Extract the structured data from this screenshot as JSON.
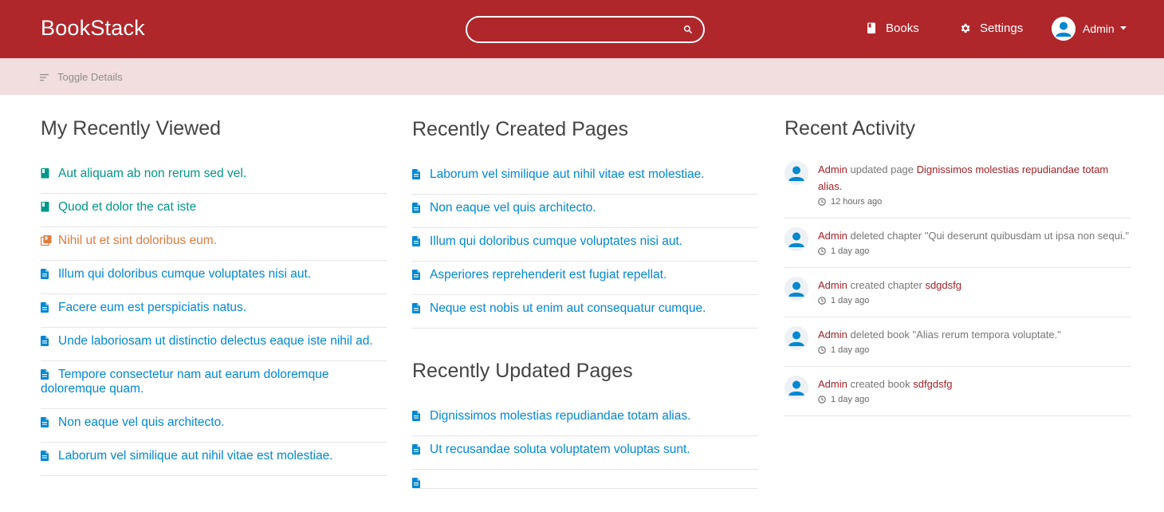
{
  "header": {
    "logo": "BookStack",
    "search_placeholder": "",
    "nav": {
      "books": "Books",
      "settings": "Settings",
      "user": "Admin"
    }
  },
  "toolbar": {
    "toggle_details": "Toggle Details"
  },
  "recently_viewed": {
    "title": "My Recently Viewed",
    "items": [
      {
        "label": "Aut aliquam ab non rerum sed vel.",
        "type": "book"
      },
      {
        "label": "Quod et dolor the cat iste",
        "type": "book"
      },
      {
        "label": "Nihil ut et sint doloribus eum.",
        "type": "shelf"
      },
      {
        "label": "Illum qui doloribus cumque voluptates nisi aut.",
        "type": "page"
      },
      {
        "label": "Facere eum est perspiciatis natus.",
        "type": "page"
      },
      {
        "label": "Unde laboriosam ut distinctio delectus eaque iste nihil ad.",
        "type": "page"
      },
      {
        "label": "Tempore consectetur nam aut earum doloremque doloremque quam.",
        "type": "page"
      },
      {
        "label": "Non eaque vel quis architecto.",
        "type": "page"
      },
      {
        "label": "Laborum vel similique aut nihil vitae est molestiae.",
        "type": "page"
      }
    ]
  },
  "recently_created": {
    "title": "Recently Created Pages",
    "items": [
      "Laborum vel similique aut nihil vitae est molestiae.",
      "Non eaque vel quis architecto.",
      "Illum qui doloribus cumque voluptates nisi aut.",
      "Asperiores reprehenderit est fugiat repellat.",
      "Neque est nobis ut enim aut consequatur cumque."
    ]
  },
  "recently_updated": {
    "title": "Recently Updated Pages",
    "items": [
      "Dignissimos molestias repudiandae totam alias.",
      "Ut recusandae soluta voluptatem voluptas sunt.",
      ""
    ]
  },
  "activity": {
    "title": "Recent Activity",
    "items": [
      {
        "user": "Admin",
        "action": "updated page",
        "target": "Dignissimos molestias repudiandae totam alias.",
        "time": "12 hours ago"
      },
      {
        "user": "Admin",
        "action": "deleted chapter \"Qui deserunt quibusdam ut ipsa non sequi.\"",
        "target": "",
        "time": "1 day ago"
      },
      {
        "user": "Admin",
        "action": "created chapter",
        "target": "sdgdsfg",
        "time": "1 day ago"
      },
      {
        "user": "Admin",
        "action": "deleted book \"Alias rerum tempora voluptate.\"",
        "target": "",
        "time": "1 day ago"
      },
      {
        "user": "Admin",
        "action": "created book",
        "target": "sdfgdsfg",
        "time": "1 day ago"
      }
    ]
  },
  "colors": {
    "primary": "#af272b",
    "book": "#009688",
    "shelf": "#e27b41",
    "page": "#0288d1",
    "toolbar_bg": "#f3dedf"
  }
}
